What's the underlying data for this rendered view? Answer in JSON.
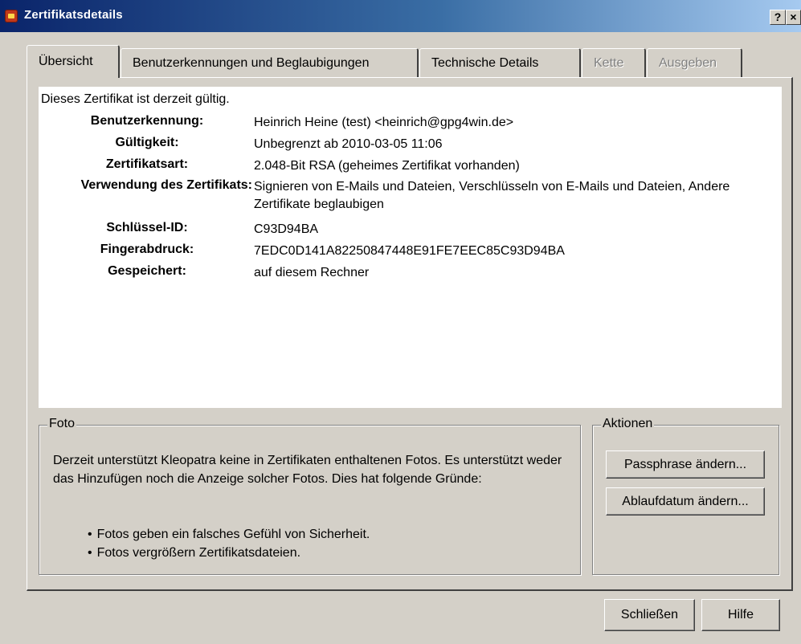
{
  "window": {
    "title": "Zertifikatsdetails",
    "help_button": "?",
    "close_button": "×"
  },
  "tabs": [
    {
      "label": "Übersicht",
      "active": true,
      "enabled": true
    },
    {
      "label": "Benutzerkennungen und Beglaubigungen",
      "active": false,
      "enabled": true
    },
    {
      "label": "Technische Details",
      "active": false,
      "enabled": true
    },
    {
      "label": "Kette",
      "active": false,
      "enabled": false
    },
    {
      "label": "Ausgeben",
      "active": false,
      "enabled": false
    }
  ],
  "overview": {
    "status": "Dieses Zertifikat ist derzeit gültig.",
    "fields": [
      {
        "label": "Benutzerkennung:",
        "value": "Heinrich Heine (test) <heinrich@gpg4win.de>"
      },
      {
        "label": "Gültigkeit:",
        "value": "Unbegrenzt ab 2010-03-05 11:06"
      },
      {
        "label": "Zertifikatsart:",
        "value": "2.048-Bit RSA (geheimes Zertifikat vorhanden)"
      },
      {
        "label": "Verwendung des Zertifikats:",
        "value": "Signieren von E-Mails und Dateien, Verschlüsseln von E-Mails und Dateien, Andere Zertifikate beglaubigen"
      },
      {
        "label": "Schlüssel-ID:",
        "value": "C93D94BA"
      },
      {
        "label": "Fingerabdruck:",
        "value": "7EDC0D141A82250847448E91FE7EEC85C93D94BA"
      },
      {
        "label": "Gespeichert:",
        "value": "auf diesem Rechner"
      }
    ]
  },
  "foto": {
    "title": "Foto",
    "text": "Derzeit unterstützt Kleopatra keine in Zertifikaten enthaltenen Fotos. Es unterstützt weder das Hinzufügen noch die Anzeige solcher Fotos. Dies hat folgende Gründe:",
    "bullets": [
      "Fotos geben ein falsches Gefühl von Sicherheit.",
      "Fotos vergrößern Zertifikatsdateien."
    ]
  },
  "actions": {
    "title": "Aktionen",
    "change_passphrase": "Passphrase ändern...",
    "change_expiry": "Ablaufdatum ändern..."
  },
  "footer": {
    "close_label": "Schließen",
    "help_label": "Hilfe"
  }
}
